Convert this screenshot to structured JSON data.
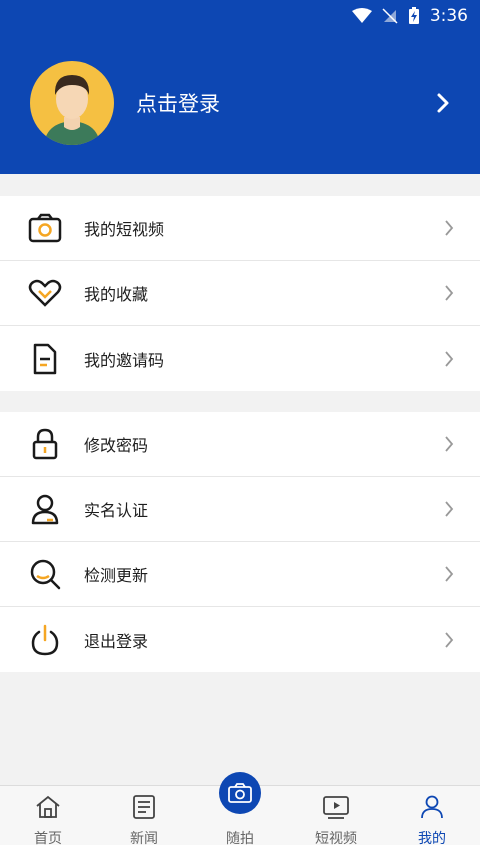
{
  "status_bar": {
    "time": "3:36"
  },
  "header": {
    "login_text": "点击登录"
  },
  "menu_group_1": [
    {
      "label": "我的短视频",
      "icon": "camera-icon"
    },
    {
      "label": "我的收藏",
      "icon": "heart-icon"
    },
    {
      "label": "我的邀请码",
      "icon": "document-icon"
    }
  ],
  "menu_group_2": [
    {
      "label": "修改密码",
      "icon": "lock-icon"
    },
    {
      "label": "实名认证",
      "icon": "user-icon"
    },
    {
      "label": "检测更新",
      "icon": "search-icon"
    },
    {
      "label": "退出登录",
      "icon": "power-icon"
    }
  ],
  "bottom_nav": [
    {
      "label": "首页",
      "icon": "home-icon"
    },
    {
      "label": "新闻",
      "icon": "news-icon"
    },
    {
      "label": "随拍",
      "icon": "camera-icon"
    },
    {
      "label": "短视频",
      "icon": "video-icon"
    },
    {
      "label": "我的",
      "icon": "profile-icon",
      "active": true
    }
  ],
  "colors": {
    "primary": "#0d47b3",
    "accent": "#f5a623",
    "avatar_bg": "#f5c042"
  }
}
